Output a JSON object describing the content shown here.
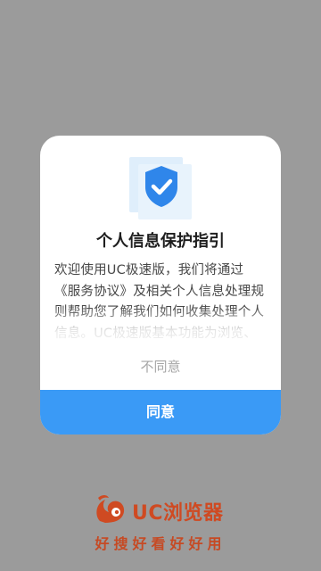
{
  "dialog": {
    "title": "个人信息保护指引",
    "body": "欢迎使用UC极速版，我们将通过《服务协议》及相关个人信息处理规则帮助您了解我们如何收集处理个人信息。UC极速版基本功能为浏览、搜索、资讯、小说视频等阅读服务",
    "disagree_label": "不同意",
    "agree_label": "同意",
    "icon": "shield-check-icon"
  },
  "brand": {
    "name": "UC浏览器",
    "slogan": "好搜好看好好用",
    "logo_icon": "uc-squirrel-logo-icon"
  },
  "colors": {
    "accent": "#3a9af6",
    "brand": "#cf4a22",
    "overlay": "#9b9b9b"
  }
}
